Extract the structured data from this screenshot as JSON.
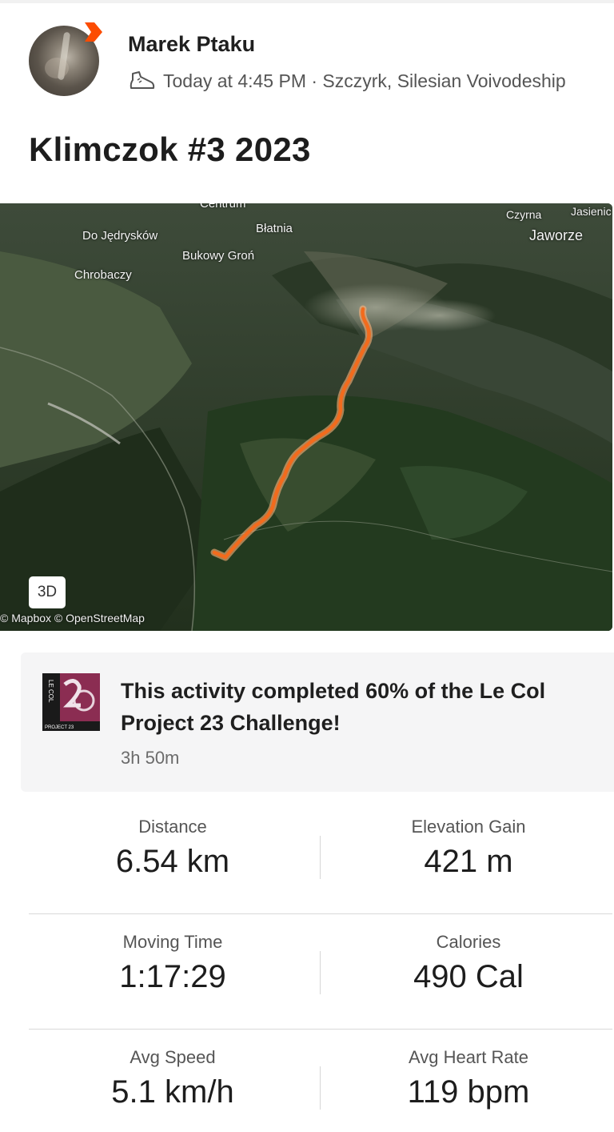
{
  "user": {
    "name": "Marek Ptaku",
    "meta": "Today at 4:45 PM · Szczyrk, Silesian Voivodeship",
    "avatar_icon": "avatar-photo",
    "badge_color": "#fc4c02"
  },
  "activity": {
    "title": "Klimczok #3 2023"
  },
  "map": {
    "labels": {
      "top_cut": "Centrum",
      "do_jedryskow": "Do Jędrysków",
      "blatnia": "Błatnia",
      "bukowy_gron": "Bukowy Groń",
      "chrobaczy": "Chrobaczy",
      "czyrna": "Czyrna",
      "jasienica": "Jasienic",
      "jaworze": "Jaworze"
    },
    "view_button": "3D",
    "attribution": "© Mapbox © OpenStreetMap",
    "route_color": "#f26b1d"
  },
  "challenge": {
    "logo_text": "LE COL",
    "logo_number": "23",
    "logo_caption": "PROJECT 23",
    "text": "This activity completed 60% of the Le Col Project 23 Challenge!",
    "duration": "3h 50m"
  },
  "stats": [
    {
      "label": "Distance",
      "value": "6.54 km"
    },
    {
      "label": "Elevation Gain",
      "value": "421 m"
    },
    {
      "label": "Moving Time",
      "value": "1:17:29"
    },
    {
      "label": "Calories",
      "value": "490 Cal"
    },
    {
      "label": "Avg Speed",
      "value": "5.1 km/h"
    },
    {
      "label": "Avg Heart Rate",
      "value": "119 bpm"
    }
  ]
}
